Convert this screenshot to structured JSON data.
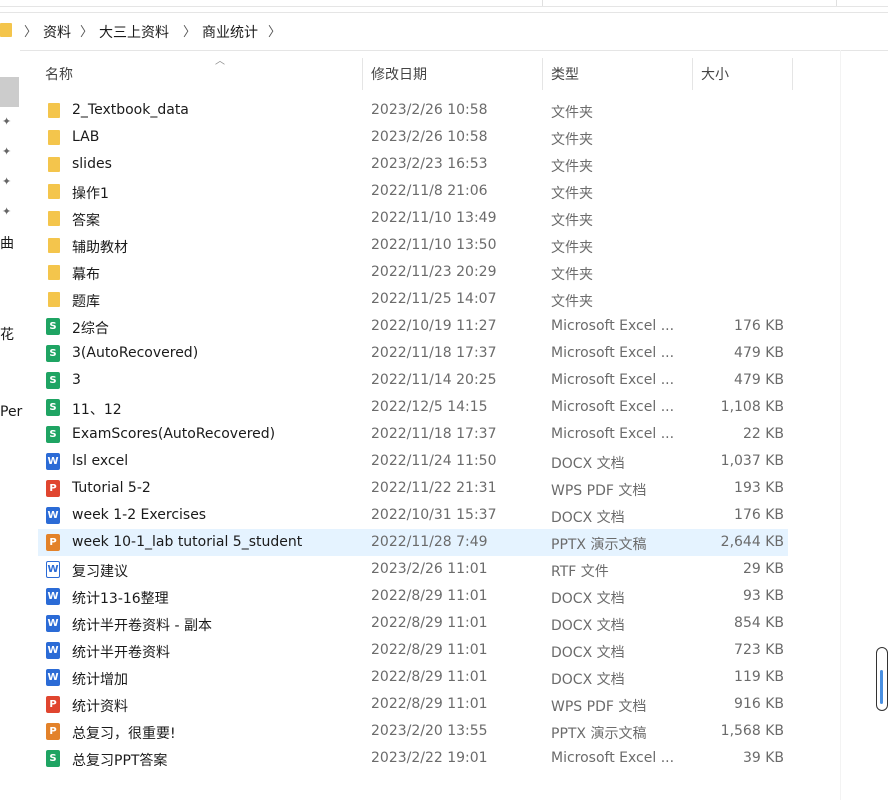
{
  "breadcrumb": [
    "资料",
    "大三上资料",
    "商业统计"
  ],
  "columns": {
    "name": "名称",
    "date": "修改日期",
    "type": "类型",
    "size": "大小"
  },
  "nav_fragments": [
    "曲",
    "花",
    "Per"
  ],
  "files": [
    {
      "name": "2_Textbook_data",
      "date": "2023/2/26 10:58",
      "type": "文件夹",
      "size": "",
      "icon": "folder-icon"
    },
    {
      "name": "LAB",
      "date": "2023/2/26 10:58",
      "type": "文件夹",
      "size": "",
      "icon": "folder-icon"
    },
    {
      "name": "slides",
      "date": "2023/2/23 16:53",
      "type": "文件夹",
      "size": "",
      "icon": "folder-icon"
    },
    {
      "name": "操作1",
      "date": "2022/11/8 21:06",
      "type": "文件夹",
      "size": "",
      "icon": "folder-icon"
    },
    {
      "name": "答案",
      "date": "2022/11/10 13:49",
      "type": "文件夹",
      "size": "",
      "icon": "folder-icon"
    },
    {
      "name": "辅助教材",
      "date": "2022/11/10 13:50",
      "type": "文件夹",
      "size": "",
      "icon": "folder-icon"
    },
    {
      "name": "幕布",
      "date": "2022/11/23 20:29",
      "type": "文件夹",
      "size": "",
      "icon": "folder-icon"
    },
    {
      "name": "题库",
      "date": "2022/11/25 14:07",
      "type": "文件夹",
      "size": "",
      "icon": "folder-icon"
    },
    {
      "name": "2综合",
      "date": "2022/10/19 11:27",
      "type": "Microsoft Excel ...",
      "size": "176 KB",
      "icon": "excel-icon"
    },
    {
      "name": "3(AutoRecovered)",
      "date": "2022/11/18 17:37",
      "type": "Microsoft Excel ...",
      "size": "479 KB",
      "icon": "excel-icon"
    },
    {
      "name": "3",
      "date": "2022/11/14 20:25",
      "type": "Microsoft Excel ...",
      "size": "479 KB",
      "icon": "excel-icon"
    },
    {
      "name": "11、12",
      "date": "2022/12/5 14:15",
      "type": "Microsoft Excel ...",
      "size": "1,108 KB",
      "icon": "excel-icon"
    },
    {
      "name": "ExamScores(AutoRecovered)",
      "date": "2022/11/18 17:37",
      "type": "Microsoft Excel ...",
      "size": "22 KB",
      "icon": "excel-icon"
    },
    {
      "name": "lsl excel",
      "date": "2022/11/24 11:50",
      "type": "DOCX 文档",
      "size": "1,037 KB",
      "icon": "word-icon"
    },
    {
      "name": "Tutorial 5-2",
      "date": "2022/11/22 21:31",
      "type": "WPS PDF 文档",
      "size": "193 KB",
      "icon": "pdf-icon"
    },
    {
      "name": "week 1-2 Exercises",
      "date": "2022/10/31 15:37",
      "type": "DOCX 文档",
      "size": "176 KB",
      "icon": "word-icon"
    },
    {
      "name": "week 10-1_lab tutorial 5_student",
      "date": "2022/11/28 7:49",
      "type": "PPTX 演示文稿",
      "size": "2,644 KB",
      "icon": "ppt-icon",
      "selected": true
    },
    {
      "name": "复习建议",
      "date": "2023/2/26 11:01",
      "type": "RTF 文件",
      "size": "29 KB",
      "icon": "rtf-icon"
    },
    {
      "name": "统计13-16整理",
      "date": "2022/8/29 11:01",
      "type": "DOCX 文档",
      "size": "93 KB",
      "icon": "word-icon"
    },
    {
      "name": "统计半开卷资料 - 副本",
      "date": "2022/8/29 11:01",
      "type": "DOCX 文档",
      "size": "854 KB",
      "icon": "word-icon"
    },
    {
      "name": "统计半开卷资料",
      "date": "2022/8/29 11:01",
      "type": "DOCX 文档",
      "size": "723 KB",
      "icon": "word-icon"
    },
    {
      "name": "统计增加",
      "date": "2022/8/29 11:01",
      "type": "DOCX 文档",
      "size": "119 KB",
      "icon": "word-icon"
    },
    {
      "name": "统计资料",
      "date": "2022/8/29 11:01",
      "type": "WPS PDF 文档",
      "size": "916 KB",
      "icon": "pdf-icon"
    },
    {
      "name": "总复习，很重要!",
      "date": "2023/2/20 13:55",
      "type": "PPTX 演示文稿",
      "size": "1,568 KB",
      "icon": "ppt-icon"
    },
    {
      "name": "总复习PPT答案",
      "date": "2023/2/22 19:01",
      "type": "Microsoft Excel ...",
      "size": "39 KB",
      "icon": "excel-icon"
    }
  ]
}
